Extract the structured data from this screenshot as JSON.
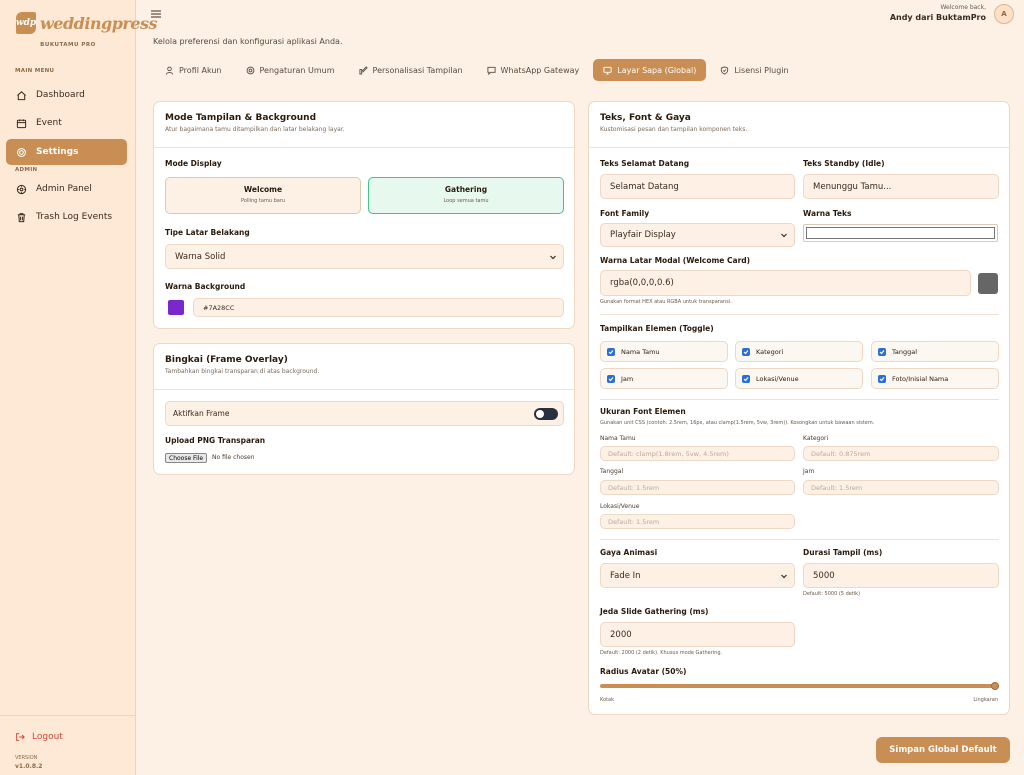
{
  "brand": {
    "name": "weddingpress",
    "mark": "wdp",
    "subtitle": "BUKUTAMU PRO"
  },
  "sidebar": {
    "main_label": "MAIN MENU",
    "admin_label": "ADMIN",
    "items": [
      {
        "label": "Dashboard",
        "icon": "home-icon"
      },
      {
        "label": "Event",
        "icon": "calendar-icon"
      },
      {
        "label": "Settings",
        "icon": "settings-icon",
        "active": true
      }
    ],
    "admin_items": [
      {
        "label": "Admin Panel",
        "icon": "admin-icon"
      },
      {
        "label": "Trash Log Events",
        "icon": "trash-icon"
      }
    ],
    "logout": "Logout",
    "version_label": "VERSION",
    "version": "v1.0.8.2"
  },
  "header": {
    "welcome": "Welcome back,",
    "user": "Andy dari BuktamPro",
    "avatar_initial": "A",
    "subtitle": "Kelola preferensi dan konfigurasi aplikasi Anda."
  },
  "tabs": [
    {
      "label": "Profil Akun",
      "icon": "user-icon"
    },
    {
      "label": "Pengaturan Umum",
      "icon": "gear-icon"
    },
    {
      "label": "Personalisasi Tampilan",
      "icon": "brush-icon"
    },
    {
      "label": "WhatsApp Gateway",
      "icon": "chat-icon"
    },
    {
      "label": "Layar Sapa (Global)",
      "icon": "monitor-icon",
      "active": true
    },
    {
      "label": "Lisensi Plugin",
      "icon": "shield-icon"
    }
  ],
  "mode_card": {
    "title": "Mode Tampilan & Background",
    "subtitle": "Atur bagaimana tamu ditampilkan dan latar belakang layar.",
    "mode_label": "Mode Display",
    "modes": [
      {
        "title": "Welcome",
        "desc": "Polling tamu baru"
      },
      {
        "title": "Gathering",
        "desc": "Loop semua tamu",
        "selected": true
      }
    ],
    "bg_type_label": "Tipe Latar Belakang",
    "bg_type_value": "Warna Solid",
    "bg_color_label": "Warna Background",
    "bg_color_value": "#7A28CC",
    "swatch_color": "#7A28CC"
  },
  "frame_card": {
    "title": "Bingkai (Frame Overlay)",
    "subtitle": "Tambahkan bingkai transparan di atas background.",
    "toggle_label": "Aktifkan Frame",
    "upload_label": "Upload PNG Transparan",
    "file_button": "Choose File",
    "file_status": "No file chosen"
  },
  "text_card": {
    "title": "Teks, Font & Gaya",
    "subtitle": "Kustomisasi pesan dan tampilan komponen teks.",
    "welcome_text_label": "Teks Selamat Datang",
    "welcome_text_value": "Selamat Datang",
    "standby_label": "Teks Standby (Idle)",
    "standby_value": "Menunggu Tamu...",
    "font_family_label": "Font Family",
    "font_family_value": "Playfair Display",
    "text_color_label": "Warna Teks",
    "modal_bg_label": "Warna Latar Modal (Welcome Card)",
    "modal_bg_value": "rgba(0,0,0,0.6)",
    "modal_bg_hint": "Gunakan format HEX atau RGBA untuk transparansi.",
    "modal_swatch_color": "#666666",
    "toggle_section_label": "Tampilkan Elemen (Toggle)",
    "toggles": [
      "Nama Tamu",
      "Kategori",
      "Tanggal",
      "Jam",
      "Lokasi/Venue",
      "Foto/Inisial Nama"
    ],
    "font_size_label": "Ukuran Font Elemen",
    "font_size_hint": "Gunakan unit CSS (contoh: 2.5rem, 16px, atau clamp(1.5rem, 5vw, 3rem)). Kosongkan untuk bawaan sistem.",
    "sizes": {
      "nama_label": "Nama Tamu",
      "nama_ph": "Default: clamp(1.8rem, 5vw, 4.5rem)",
      "kategori_label": "Kategori",
      "kategori_ph": "Default: 0.875rem",
      "tanggal_label": "Tanggal",
      "tanggal_ph": "Default: 1.5rem",
      "jam_label": "Jam",
      "jam_ph": "Default: 1.5rem",
      "lokasi_label": "Lokasi/Venue",
      "lokasi_ph": "Default: 1.5rem"
    },
    "anim_label": "Gaya Animasi",
    "anim_value": "Fade In",
    "duration_label": "Durasi Tampil (ms)",
    "duration_value": "5000",
    "duration_hint": "Default: 5000 (5 detik)",
    "slide_label": "Jeda Slide Gathering (ms)",
    "slide_value": "2000",
    "slide_hint": "Default: 2000 (2 detik). Khusus mode Gathering.",
    "radius_label": "Radius Avatar (50%)",
    "radius_level": 1.0,
    "radius_min": "Kotak",
    "radius_max": "Lingkaran"
  },
  "save_button": "Simpan Global Default",
  "colors": {
    "accent": "#C88E54",
    "bg": "#FDF1E6",
    "sidebar": "#FDE9D6",
    "selected": "#45C08A",
    "danger": "#D04A3A"
  }
}
